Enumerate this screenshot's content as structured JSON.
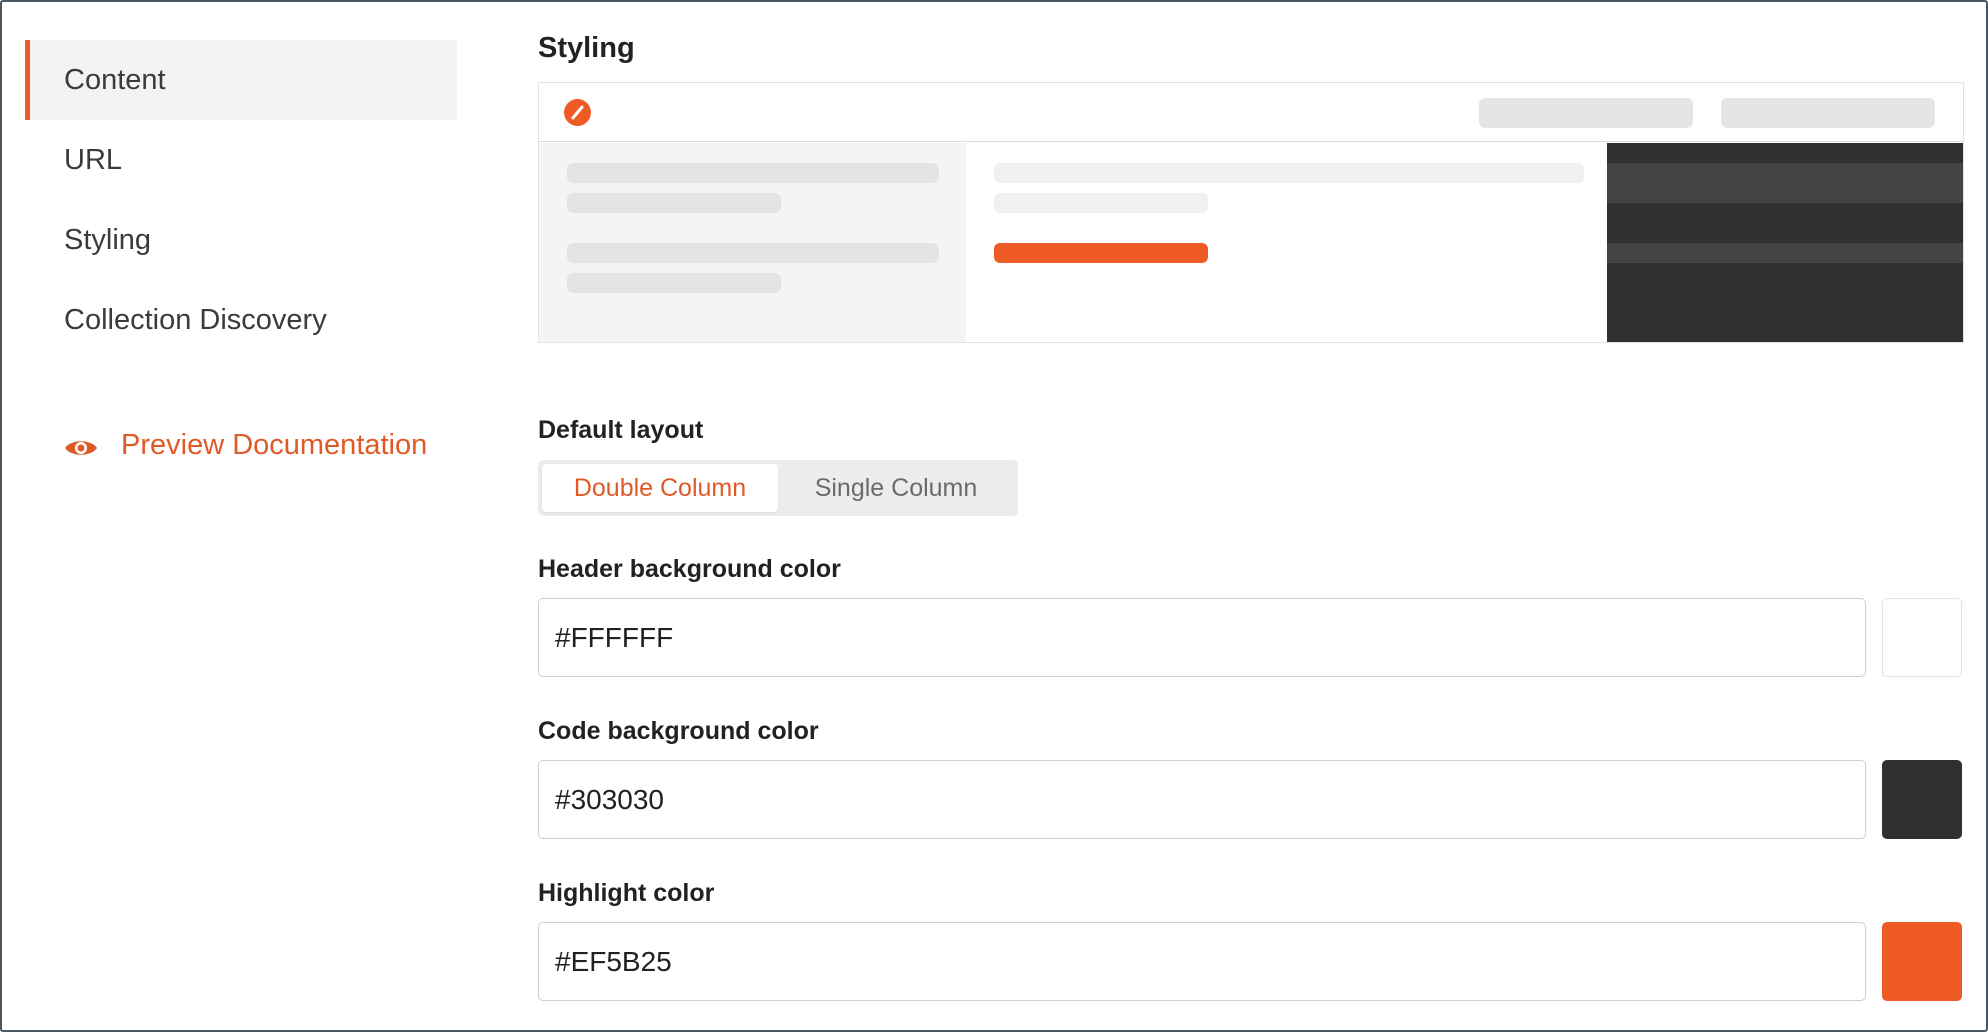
{
  "sidebar": {
    "items": [
      {
        "label": "Content",
        "active": true
      },
      {
        "label": "URL",
        "active": false
      },
      {
        "label": "Styling",
        "active": false
      },
      {
        "label": "Collection Discovery",
        "active": false
      }
    ],
    "preview_link": {
      "label": "Preview Documentation",
      "icon": "eye-icon"
    }
  },
  "main": {
    "title": "Styling",
    "layout": {
      "label": "Default layout",
      "options": [
        "Double Column",
        "Single Column"
      ],
      "selected": "Double Column"
    },
    "header_bg": {
      "label": "Header background color",
      "value": "#FFFFFF",
      "swatch": "#FFFFFF"
    },
    "code_bg": {
      "label": "Code background color",
      "value": "#303030",
      "swatch": "#303030"
    },
    "highlight": {
      "label": "Highlight color",
      "value": "#EF5B25",
      "swatch": "#EF5B25"
    }
  },
  "colors": {
    "accent": "#EF5B25",
    "link": "#E05A27",
    "code_dark": "#303030"
  }
}
